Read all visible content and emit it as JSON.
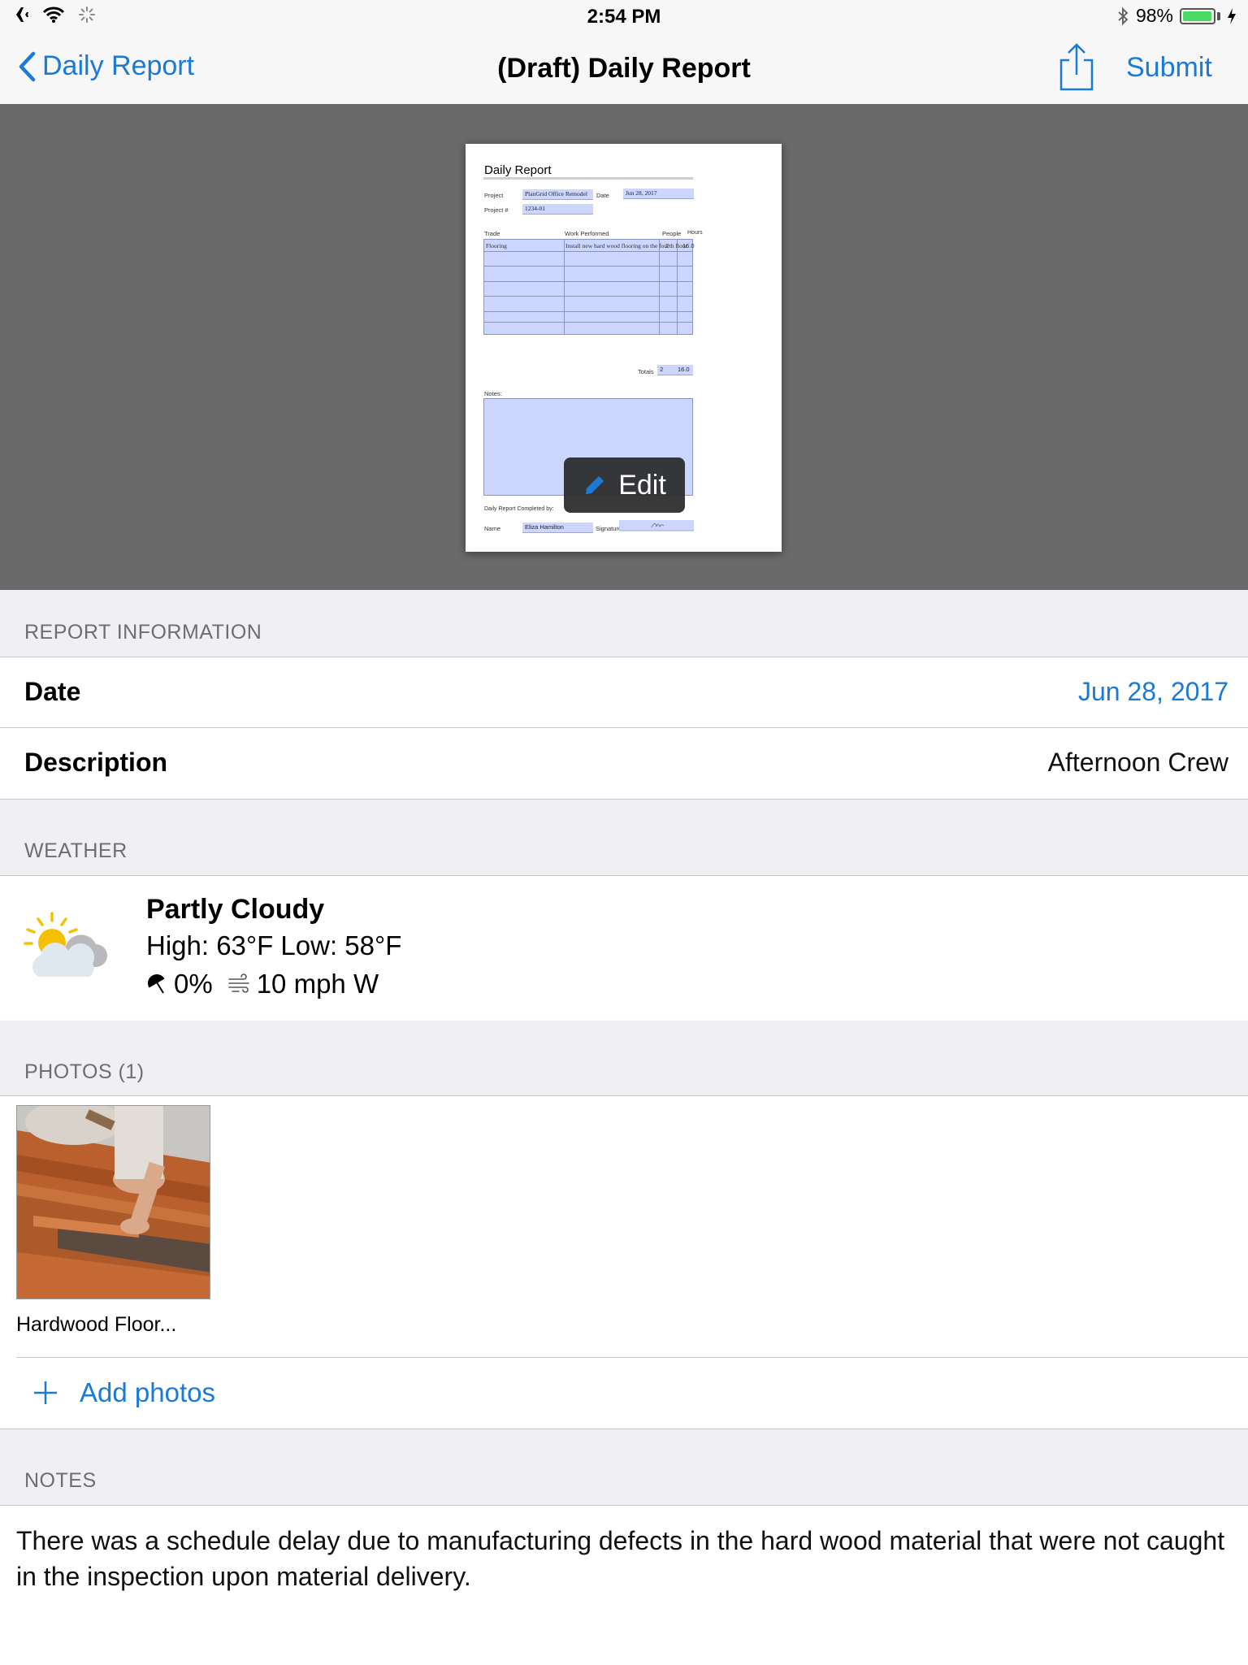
{
  "status": {
    "time": "2:54 PM",
    "battery": "98%",
    "battery_level": 0.98
  },
  "nav": {
    "back_label": "Daily Report",
    "title": "(Draft) Daily Report",
    "submit_label": "Submit"
  },
  "document": {
    "title": "Daily Report",
    "project_label": "Project",
    "project_value": "PlanGrid Office Remodel",
    "date_label": "Date",
    "date_value": "Jun 28, 2017",
    "projectno_label": "Project #",
    "projectno_value": "1234-01",
    "col_trade": "Trade",
    "col_work": "Work Performed",
    "col_people": "People",
    "col_hours": "Hours",
    "row_trade": "Flooring",
    "row_work": "Install new hard wood flooring on the fourth floor",
    "row_people": "2",
    "row_hours": "16.0",
    "totals_label": "Totals",
    "totals_people": "2",
    "totals_hours": "16.0",
    "notes_label": "Notes:",
    "completed_label": "Daily Report Completed by:",
    "name_label": "Name",
    "name_value": "Eliza Hamilton",
    "signature_label": "Signature",
    "edit_label": "Edit"
  },
  "report_info": {
    "header": "REPORT INFORMATION",
    "date_label": "Date",
    "date_value": "Jun 28, 2017",
    "description_label": "Description",
    "description_value": "Afternoon Crew"
  },
  "weather": {
    "header": "WEATHER",
    "condition": "Partly Cloudy",
    "temps": "High: 63°F Low: 58°F",
    "precip": "0%",
    "wind": "10 mph W"
  },
  "photos": {
    "header": "PHOTOS (1)",
    "items": [
      {
        "caption": "Hardwood Floor..."
      }
    ],
    "add_label": "Add photos"
  },
  "notes": {
    "header": "NOTES",
    "text": "There was a schedule delay due to manufacturing defects in the hard wood material that were not caught in the inspection upon material delivery."
  },
  "colors": {
    "accent": "#1a7ad6",
    "group_bg": "#efeff4",
    "preview_bg": "#6a6a6a"
  }
}
